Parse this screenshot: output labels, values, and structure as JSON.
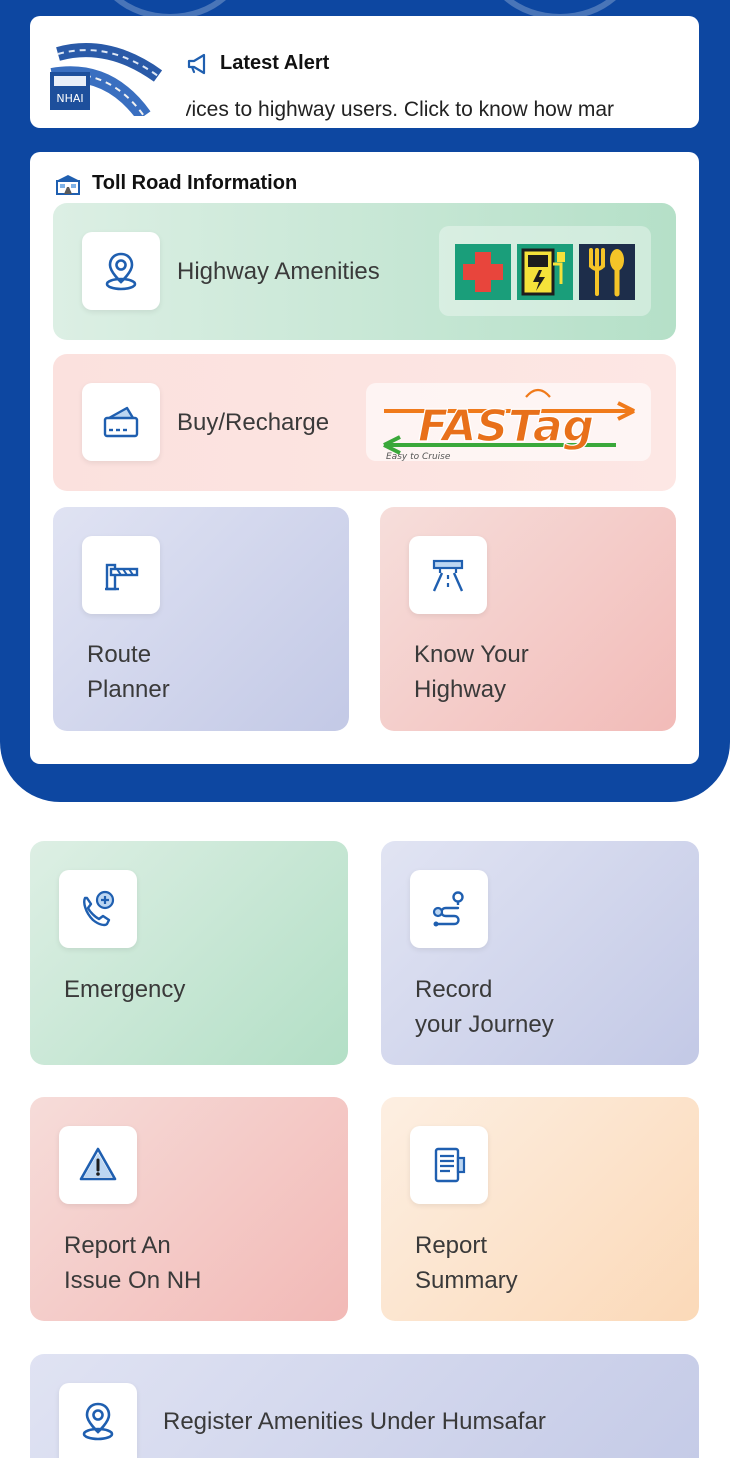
{
  "alert": {
    "title": "Latest Alert",
    "ticker_text": "rvices to highway users. Click to know how mar",
    "logo_text": "NHAI"
  },
  "toll": {
    "title": "Toll Road Information",
    "highway_amenities_label": "Highway Amenities",
    "buy_recharge_label": "Buy/Recharge",
    "fastag_brand": "FASTag",
    "fastag_tagline": "Easy to Cruise",
    "route_planner_line1": "Route",
    "route_planner_line2": "Planner",
    "know_highway_line1": "Know Your",
    "know_highway_line2": "Highway"
  },
  "services": {
    "emergency_label": "Emergency",
    "record_line1": "Record",
    "record_line2": "your Journey",
    "report_issue_line1": "Report An",
    "report_issue_line2": "Issue On NH",
    "report_summary_line1": "Report",
    "report_summary_line2": "Summary",
    "register_label": "Register Amenities Under Humsafar"
  },
  "colors": {
    "primary": "#0d47a1",
    "icon_blue": "#1f5fb0",
    "green_tile": "#b5e0c8",
    "pink_tile": "#f2bbb8",
    "lavender_tile": "#c3c9e6",
    "peach_tile": "#fbd9b8"
  },
  "icons": [
    "megaphone-icon",
    "toll-booth-icon",
    "location-pin-icon",
    "first-aid-icon",
    "ev-charging-icon",
    "restaurant-icon",
    "payment-card-icon",
    "toll-barrier-icon",
    "highway-road-icon",
    "emergency-phone-icon",
    "route-path-icon",
    "warning-icon",
    "report-document-icon"
  ]
}
